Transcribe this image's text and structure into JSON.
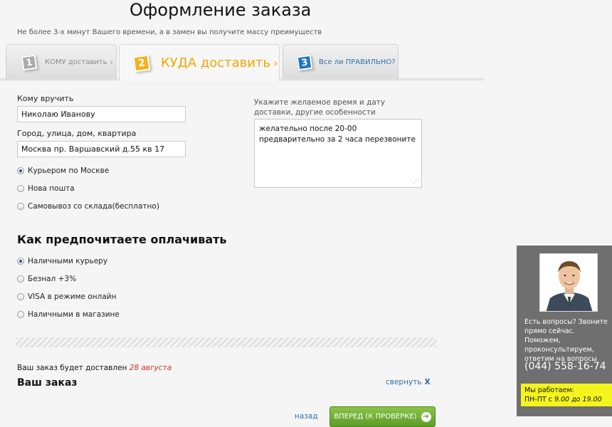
{
  "header": {
    "title": "Оформление заказа",
    "subtitle": "Не более 3-х минут Вашего времени, а в замен вы получите массу преимуществ"
  },
  "tabs": [
    {
      "number": "1",
      "label": "КОМУ доставить",
      "arrow": "›",
      "state": "inactive"
    },
    {
      "number": "2",
      "label": "КУДА доставить",
      "arrow": "›",
      "state": "active"
    },
    {
      "number": "3",
      "label": "Все ли ПРАВИЛЬНО?",
      "arrow": "",
      "state": "inactive"
    }
  ],
  "form": {
    "recipient_label": "Кому вручить",
    "recipient_value": "Николаю Иванову",
    "address_label": "Город, улица, дом, квартира",
    "address_value": "Москва пр. Варшавский д.55 кв 17",
    "notes_label": "Укажите желаемое время и дату доставки, другие особенности",
    "notes_value": "желательно после 20-00\nпредварительно за 2 часа перезвоните"
  },
  "delivery_options": [
    {
      "label": "Курьером по Москве",
      "checked": true
    },
    {
      "label": "Нова пошта",
      "checked": false
    },
    {
      "label": "Самовывоз со склада(бесплатно)",
      "checked": false
    }
  ],
  "payment": {
    "heading": "Как предпочитаете оплачивать",
    "options": [
      {
        "label": "Наличными курьеру",
        "checked": true
      },
      {
        "label": "Безнал +3%",
        "checked": false
      },
      {
        "label": "VISA в режиме онлайн",
        "checked": false
      },
      {
        "label": "Наличными в магазине",
        "checked": false
      }
    ]
  },
  "order": {
    "delivery_text": "Ваш заказ будет доставлен",
    "delivery_date": "28 августа",
    "heading": "Ваш заказ",
    "collapse_label": "свернуть",
    "collapse_x": "X"
  },
  "footer": {
    "back_label": "назад",
    "next_label": "ВПЕРЕД (К ПРОВЕРКЕ)",
    "next_arrow": "➔"
  },
  "help": {
    "text": "Есть вопросы? Звоните прямо сейчас. Поможем, проконсультируем, ответим на вопросы",
    "phone": "(044) 558-16-74",
    "hours_label": "Мы работаем:",
    "hours_days": "ПН-ПТ с",
    "hours_time": "9.00 до 19.00"
  },
  "colors": {
    "accent_orange": "#f2a700",
    "link_blue": "#2a6fb0",
    "button_green": "#6aaa2e",
    "date_red": "#e0302a",
    "panel_gray": "#6f6f6f",
    "hours_yellow": "#f5f51e"
  }
}
